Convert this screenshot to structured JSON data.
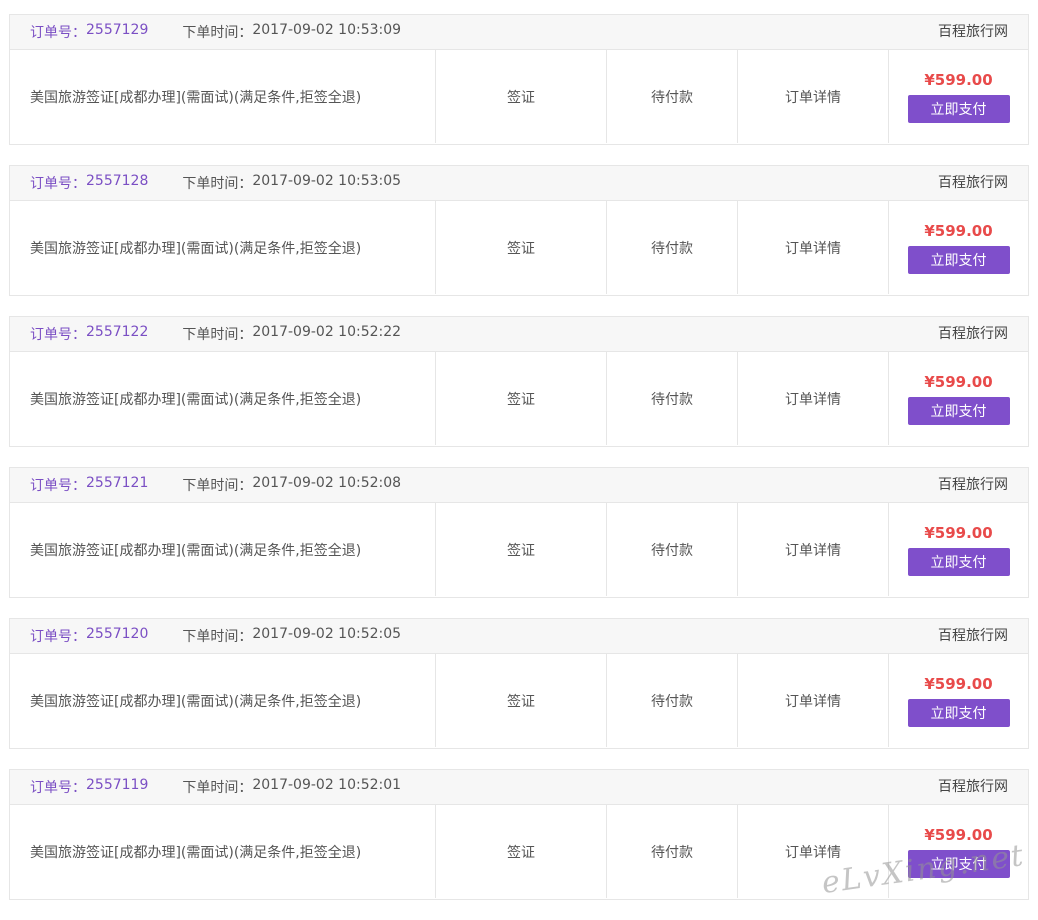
{
  "labels": {
    "order_no_prefix": "订单号：",
    "order_time_prefix": "下单时间：",
    "pay_button": "立即支付",
    "detail_link": "订单详情"
  },
  "colors": {
    "accent_purple": "#7f4fcb",
    "order_no_color": "#7b4fc4",
    "price_red": "#e84a4a",
    "header_bg": "#f7f7f7",
    "border": "#e6e6e6"
  },
  "orders": [
    {
      "order_no": "2557129",
      "time": "2017-09-02 10:53:09",
      "site": "百程旅行网",
      "title": "美国旅游签证[成都办理](需面试)(满足条件,拒签全退)",
      "type": "签证",
      "status": "待付款",
      "price": "¥599.00"
    },
    {
      "order_no": "2557128",
      "time": "2017-09-02 10:53:05",
      "site": "百程旅行网",
      "title": "美国旅游签证[成都办理](需面试)(满足条件,拒签全退)",
      "type": "签证",
      "status": "待付款",
      "price": "¥599.00"
    },
    {
      "order_no": "2557122",
      "time": "2017-09-02 10:52:22",
      "site": "百程旅行网",
      "title": "美国旅游签证[成都办理](需面试)(满足条件,拒签全退)",
      "type": "签证",
      "status": "待付款",
      "price": "¥599.00"
    },
    {
      "order_no": "2557121",
      "time": "2017-09-02 10:52:08",
      "site": "百程旅行网",
      "title": "美国旅游签证[成都办理](需面试)(满足条件,拒签全退)",
      "type": "签证",
      "status": "待付款",
      "price": "¥599.00"
    },
    {
      "order_no": "2557120",
      "time": "2017-09-02 10:52:05",
      "site": "百程旅行网",
      "title": "美国旅游签证[成都办理](需面试)(满足条件,拒签全退)",
      "type": "签证",
      "status": "待付款",
      "price": "¥599.00"
    },
    {
      "order_no": "2557119",
      "time": "2017-09-02 10:52:01",
      "site": "百程旅行网",
      "title": "美国旅游签证[成都办理](需面试)(满足条件,拒签全退)",
      "type": "签证",
      "status": "待付款",
      "price": "¥599.00"
    }
  ],
  "watermark": "eLvXing.net"
}
